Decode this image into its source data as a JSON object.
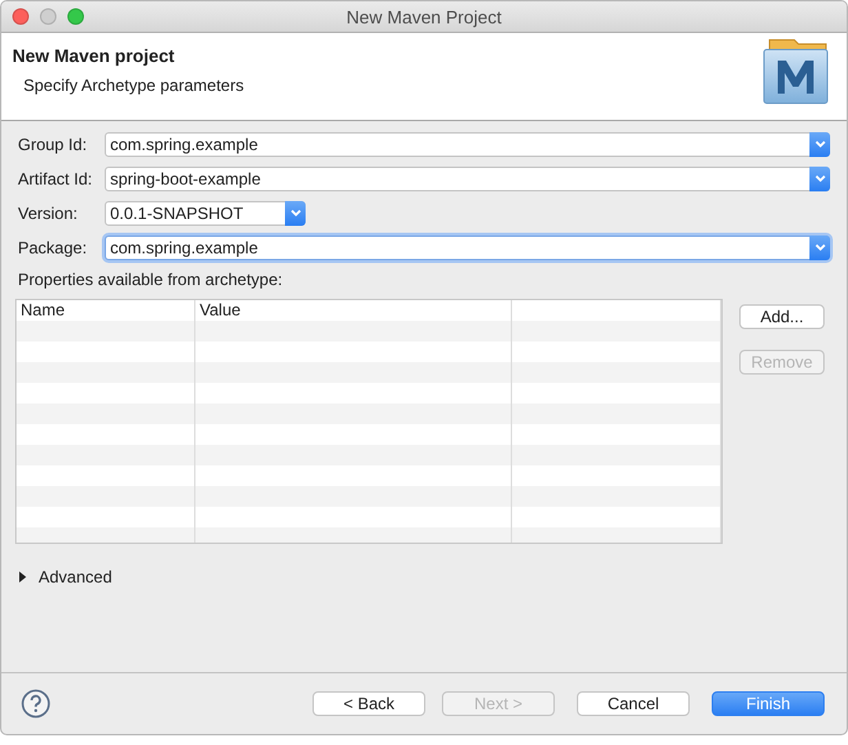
{
  "window": {
    "title": "New Maven Project"
  },
  "header": {
    "title": "New Maven project",
    "subtitle": "Specify Archetype parameters"
  },
  "fields": [
    {
      "label": "Group Id:",
      "value": "com.spring.example",
      "wide": true,
      "focused": false
    },
    {
      "label": "Artifact Id:",
      "value": "spring-boot-example",
      "wide": true,
      "focused": false
    },
    {
      "label": "Version:",
      "value": "0.0.1-SNAPSHOT",
      "wide": false,
      "focused": false
    },
    {
      "label": "Package:",
      "value": "com.spring.example",
      "wide": true,
      "focused": true
    }
  ],
  "properties": {
    "label": "Properties available from archetype:",
    "columns": [
      "Name",
      "Value"
    ],
    "buttons": [
      {
        "label": "Add...",
        "disabled": false
      },
      {
        "label": "Remove",
        "disabled": true
      }
    ]
  },
  "advanced": {
    "label": "Advanced",
    "expanded": false
  },
  "footer": {
    "buttons": [
      {
        "label": "< Back",
        "disabled": false,
        "default": false
      },
      {
        "label": "Next >",
        "disabled": true,
        "default": false
      },
      {
        "label": "Cancel",
        "disabled": false,
        "default": false
      },
      {
        "label": "Finish",
        "disabled": false,
        "default": true
      }
    ]
  }
}
